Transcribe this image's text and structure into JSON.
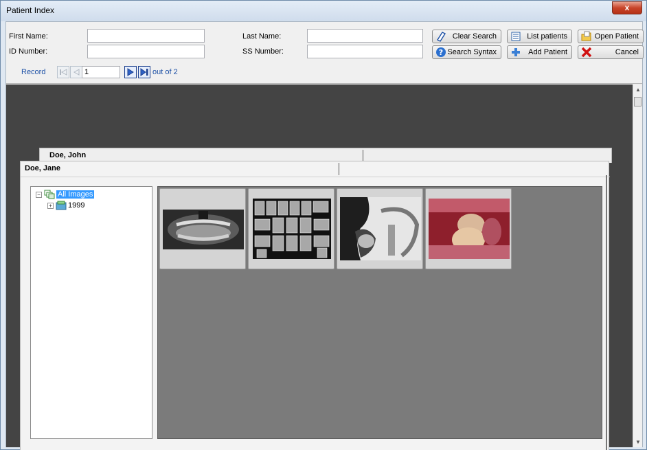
{
  "window": {
    "title": "Patient Index",
    "close_label": "x"
  },
  "search": {
    "first_name_label": "First Name:",
    "first_name_value": "",
    "last_name_label": "Last Name:",
    "last_name_value": "",
    "id_number_label": "ID Number:",
    "id_number_value": "",
    "ss_number_label": "SS Number:",
    "ss_number_value": ""
  },
  "buttons": {
    "clear_search": "Clear Search",
    "list_patients": "List patients",
    "open_patient": "Open Patient",
    "search_syntax": "Search Syntax",
    "add_patient": "Add Patient",
    "cancel": "Cancel"
  },
  "navigator": {
    "label": "Record",
    "current": "1",
    "total_text": "out of 2"
  },
  "tabs": [
    {
      "label": "Doe, John"
    },
    {
      "label": "Doe, Jane"
    }
  ],
  "tree": {
    "root": "All Images",
    "children": [
      {
        "label": "1999"
      }
    ]
  },
  "thumbnails": [
    {
      "name": "panoramic-xray"
    },
    {
      "name": "full-mouth-series"
    },
    {
      "name": "cephalometric-xray"
    },
    {
      "name": "intraoral-photo"
    }
  ],
  "colors": {
    "accent_link": "#1b4fa5",
    "selection": "#3399ff",
    "main_background": "#444444",
    "gallery_background": "#7b7b7b"
  }
}
